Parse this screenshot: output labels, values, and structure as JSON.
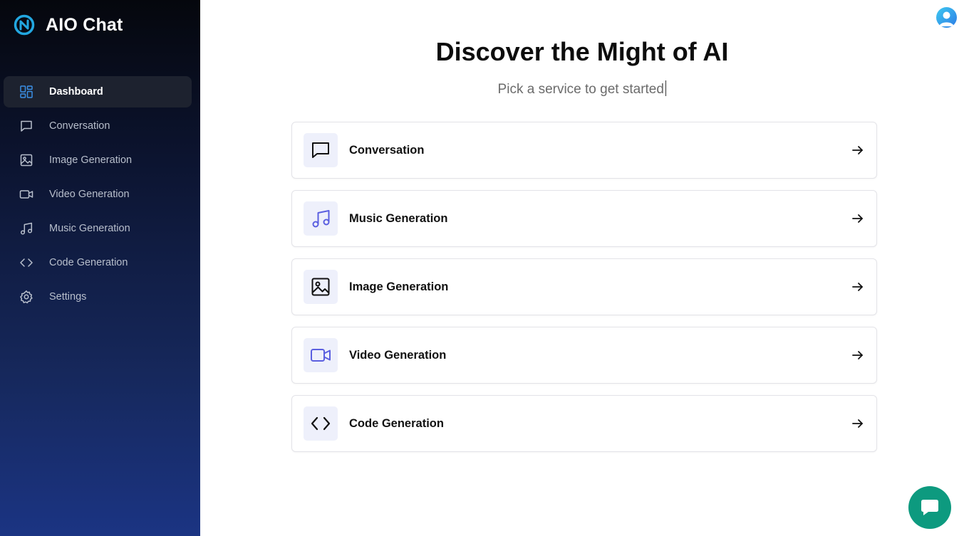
{
  "app": {
    "name": "AIO Chat",
    "logo_icon": "aio-logo-icon",
    "accent": "#22a7e0"
  },
  "sidebar": {
    "items": [
      {
        "label": "Dashboard",
        "icon": "dashboard-grid-icon",
        "active": true
      },
      {
        "label": "Conversation",
        "icon": "chat-bubble-icon",
        "active": false
      },
      {
        "label": "Image Generation",
        "icon": "image-icon",
        "active": false
      },
      {
        "label": "Video Generation",
        "icon": "video-camera-icon",
        "active": false
      },
      {
        "label": "Music Generation",
        "icon": "music-note-icon",
        "active": false
      },
      {
        "label": "Code Generation",
        "icon": "code-icon",
        "active": false
      },
      {
        "label": "Settings",
        "icon": "gear-icon",
        "active": false
      }
    ]
  },
  "main": {
    "title": "Discover the Might of AI",
    "subtitle": "Pick a service to get started",
    "services": [
      {
        "label": "Conversation",
        "icon": "chat-bubble-icon",
        "icon_color": "#111111"
      },
      {
        "label": "Music Generation",
        "icon": "music-note-icon",
        "icon_color": "#5b5fe0"
      },
      {
        "label": "Image Generation",
        "icon": "image-icon",
        "icon_color": "#111111"
      },
      {
        "label": "Video Generation",
        "icon": "video-camera-icon",
        "icon_color": "#5b5fe0"
      },
      {
        "label": "Code Generation",
        "icon": "code-icon",
        "icon_color": "#111111"
      }
    ]
  },
  "header": {
    "avatar_icon": "user-avatar-icon"
  },
  "chat_widget": {
    "icon": "chat-widget-icon",
    "color": "#0d9a7f"
  }
}
